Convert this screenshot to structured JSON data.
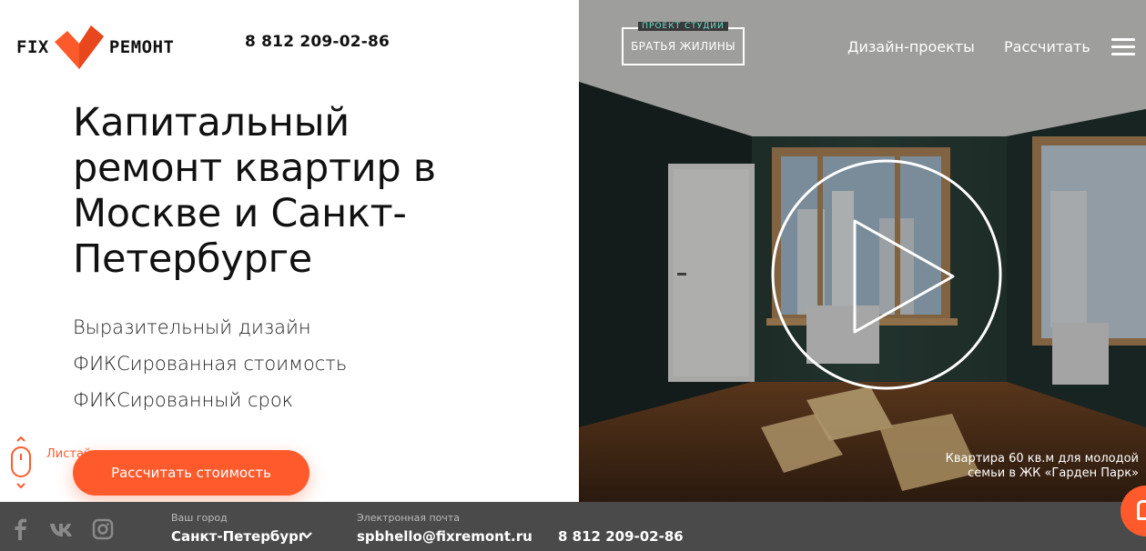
{
  "brand": {
    "word_left": "FIX",
    "word_right": "РЕМОНТ",
    "accent": "#ff5a2c"
  },
  "header": {
    "phone": "8 812 209-02-86",
    "studio": {
      "top": "ПРОЕКТ СТУДИИ",
      "name": "БРАТЬЯ ЖИЛИНЫ"
    },
    "nav": [
      "Дизайн-проекты",
      "Рассчитать"
    ]
  },
  "hero": {
    "title": "Капитальный ремонт квартир в Москве и Санкт-Петербурге",
    "features": [
      "Выразительный дизайн",
      "ФИКСированная стоимость",
      "ФИКСированный срок"
    ],
    "scroll_hint": "Листайте вниз, чтобы узнать больше",
    "cta": "Рассчитать стоимость",
    "caption": "Квартира 60 кв.м для молодой семьи в ЖК «Гарден Парк»"
  },
  "footer": {
    "social": [
      "facebook-icon",
      "vk-icon",
      "instagram-icon"
    ],
    "city_label": "Ваш город",
    "city": "Санкт-Петербург",
    "email_label": "Электронная почта",
    "email": "spbhello@fixremont.ru",
    "phone": "8 812 209-02-86"
  }
}
